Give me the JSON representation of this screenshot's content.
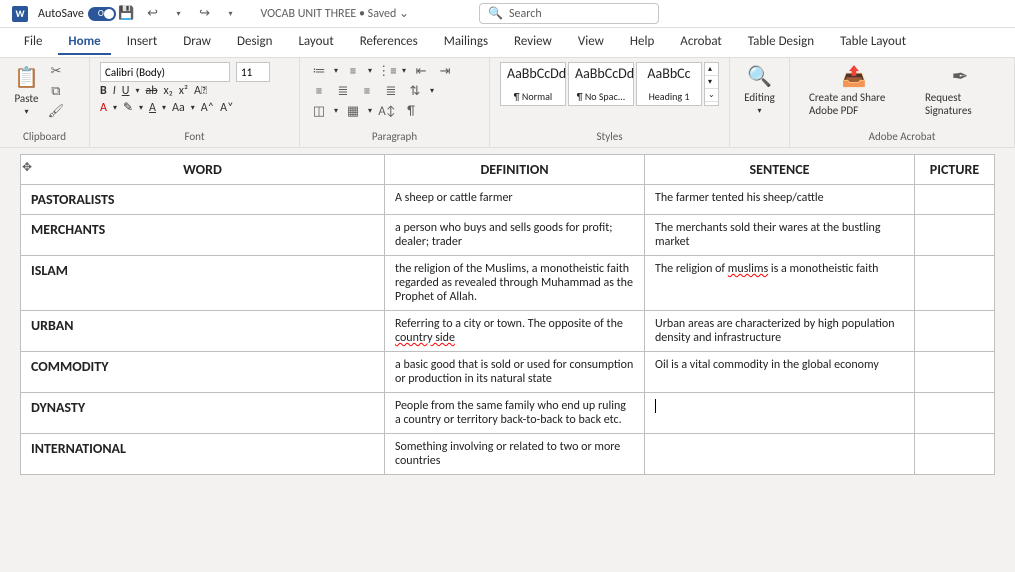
{
  "title_bar": {
    "autosave_label": "AutoSave",
    "autosave_state": "On",
    "doc_title": "VOCAB UNIT THREE • Saved ⌄",
    "search_placeholder": "Search"
  },
  "tabs": [
    "File",
    "Home",
    "Insert",
    "Draw",
    "Design",
    "Layout",
    "References",
    "Mailings",
    "Review",
    "View",
    "Help",
    "Acrobat",
    "Table Design",
    "Table Layout"
  ],
  "active_tab": "Home",
  "ribbon": {
    "clipboard": {
      "label": "Clipboard",
      "paste": "Paste"
    },
    "font": {
      "label": "Font",
      "name": "Calibri (Body)",
      "size": "11",
      "buttons": {
        "b": "B",
        "i": "I",
        "u": "U",
        "strike": "ab",
        "sub": "x₂",
        "sup": "x²",
        "clear": "A⃠",
        "color": "A",
        "highlight": "✎",
        "effects": "A",
        "case": "Aa",
        "grow": "A˄",
        "shrink": "A˅"
      }
    },
    "paragraph": {
      "label": "Paragraph"
    },
    "styles": {
      "label": "Styles",
      "items": [
        {
          "sample": "AaBbCcDd",
          "name": "¶ Normal"
        },
        {
          "sample": "AaBbCcDd",
          "name": "¶ No Spac..."
        },
        {
          "sample": "AaBbCc",
          "name": "Heading 1"
        }
      ]
    },
    "editing": "Editing",
    "acrobat": {
      "label": "Adobe Acrobat",
      "share": "Create and Share Adobe PDF",
      "request": "Request Signatures"
    }
  },
  "table": {
    "headers": [
      "WORD",
      "DEFINITION",
      "SENTENCE",
      "PICTURE"
    ],
    "rows": [
      {
        "word": "PASTORALISTS",
        "def": "A sheep or cattle farmer",
        "sent": "The farmer tented his sheep/cattle",
        "pic": ""
      },
      {
        "word": "MERCHANTS",
        "def": "a person who buys and sells goods for profit; dealer; trader",
        "sent": "The merchants sold their wares at the bustling market",
        "pic": ""
      },
      {
        "word": "ISLAM",
        "def": "the religion of the Muslims, a monotheistic faith regarded as revealed through Muhammad as the Prophet of Allah.",
        "sent_pre": "The religion of ",
        "sent_wavy": "muslims",
        "sent_post": " is a monotheistic faith",
        "pic": ""
      },
      {
        "word": "URBAN",
        "def_pre": "Referring to a city or town. The opposite of the ",
        "def_wavy": "country side",
        "sent": "Urban areas are characterized by high population density and infrastructure",
        "pic": ""
      },
      {
        "word": "COMMODITY",
        "def": "a basic good that is sold or used for consumption or production in its natural state",
        "sent": "Oil is a vital commodity in the global economy",
        "pic": ""
      },
      {
        "word": "DYNASTY",
        "def": "People from the same family who end up ruling a country or territory back-to-back to back etc.",
        "sent_cursor": true,
        "pic": ""
      },
      {
        "word": "INTERNATIONAL",
        "def": "Something involving or related to two or more countries",
        "sent": "",
        "pic": ""
      }
    ]
  }
}
